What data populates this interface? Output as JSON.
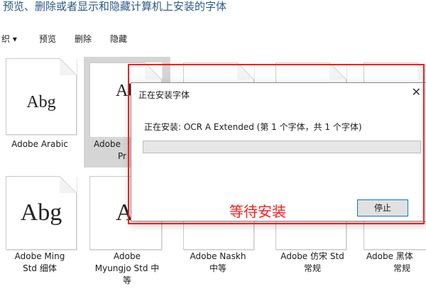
{
  "header": {
    "title": "预览、删除或者显示和隐藏计算机上安装的字体"
  },
  "toolbar": {
    "organize_label": "织 ▾",
    "preview_label": "预览",
    "delete_label": "删除",
    "hide_label": "隐藏"
  },
  "fonts": [
    {
      "sample": "Abg",
      "name": "Adobe Arabic"
    },
    {
      "sample": "Ab",
      "name": "Adobe",
      "name2": "Pr"
    },
    {
      "sample": "",
      "name": ""
    },
    {
      "sample": "",
      "name": ""
    },
    {
      "sample": "",
      "name": ""
    },
    {
      "sample": "Abg",
      "name": "Adobe Ming",
      "name2": "Std 细体"
    },
    {
      "sample": "Ab",
      "name": "Adobe",
      "name2": "Myungjo Std 中",
      "name3": "等"
    },
    {
      "sample": "",
      "name": "Adobe Naskh",
      "name2": "中等"
    },
    {
      "sample": "",
      "name": "Adobe 仿宋 Std",
      "name2": "常规"
    },
    {
      "sample": "",
      "name": "Adobe 黑体",
      "name2": "常规"
    }
  ],
  "dialog": {
    "title": "正在安装字体",
    "close_glyph": "✕",
    "status": "正在安装: OCR A Extended (第 1 个字体，共 1 个字体)",
    "progress_fraction": 0.0,
    "stop_label": "停止"
  },
  "annotation": {
    "label": "等待安装"
  },
  "colors": {
    "annotation_red": "#ff1a1a",
    "stop_border": "#0078d7"
  }
}
